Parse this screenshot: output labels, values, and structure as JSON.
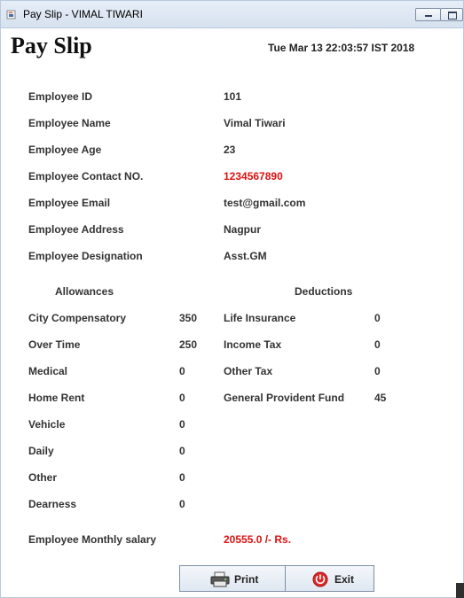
{
  "window": {
    "title": "Pay Slip - VIMAL TIWARI"
  },
  "header": {
    "heading": "Pay Slip",
    "datetime": "Tue Mar 13 22:03:57 IST 2018"
  },
  "employee": [
    {
      "label": "Employee ID",
      "value": "101"
    },
    {
      "label": "Employee Name",
      "value": "Vimal Tiwari"
    },
    {
      "label": "Employee Age",
      "value": "23"
    },
    {
      "label": "Employee Contact NO.",
      "value": "1234567890"
    },
    {
      "label": "Employee Email",
      "value": "test@gmail.com"
    },
    {
      "label": "Employee Address",
      "value": "Nagpur"
    },
    {
      "label": "Employee Designation",
      "value": "Asst.GM"
    }
  ],
  "allowances": {
    "heading": "Allowances",
    "items": [
      {
        "label": "City Compensatory",
        "value": "350"
      },
      {
        "label": "Over Time",
        "value": "250"
      },
      {
        "label": "Medical",
        "value": "0"
      },
      {
        "label": "Home Rent",
        "value": "0"
      },
      {
        "label": "Vehicle",
        "value": "0"
      },
      {
        "label": "Daily",
        "value": "0"
      },
      {
        "label": "Other",
        "value": "0"
      },
      {
        "label": "Dearness",
        "value": "0"
      }
    ]
  },
  "deductions": {
    "heading": "Deductions",
    "items": [
      {
        "label": "Life Insurance",
        "value": "0"
      },
      {
        "label": "Income Tax",
        "value": "0"
      },
      {
        "label": "Other Tax",
        "value": "0"
      },
      {
        "label": "General Provident Fund",
        "value": "45"
      }
    ]
  },
  "salary": {
    "label": "Employee Monthly salary",
    "value": "20555.0 /- Rs."
  },
  "buttons": {
    "print": "Print",
    "exit": "Exit"
  },
  "colors": {
    "highlight": "#dd1111",
    "titlebar": "#dbe5f2"
  },
  "icons": {
    "app": "java-cup-icon",
    "print": "printer-icon",
    "exit": "power-icon"
  }
}
